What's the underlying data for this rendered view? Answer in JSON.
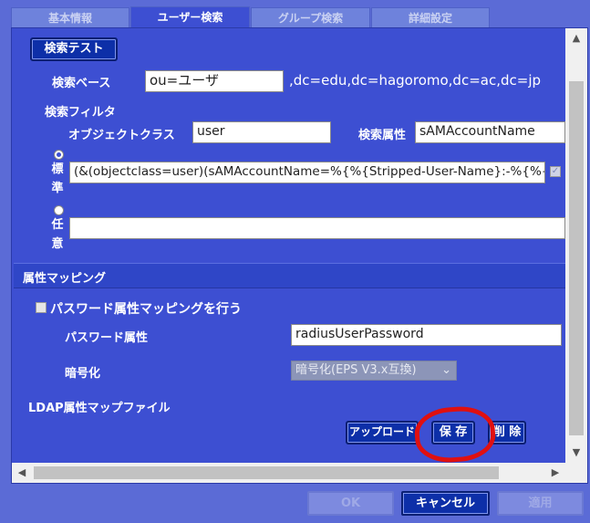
{
  "tabs": [
    {
      "label": "基本情報",
      "active": false
    },
    {
      "label": "ユーザー検索",
      "active": true
    },
    {
      "label": "グループ検索",
      "active": false
    },
    {
      "label": "詳細設定",
      "active": false
    }
  ],
  "search_test_button": "検索テスト",
  "search_base": {
    "label": "検索ベース",
    "value": "ou=ユーザ",
    "suffix": ",dc=edu,dc=hagoromo,dc=ac,dc=jp"
  },
  "search_filter": {
    "heading": "検索フィルタ",
    "object_class_label": "オブジェクトクラス",
    "object_class_value": "user",
    "search_attr_label": "検索属性",
    "search_attr_value": "sAMAccountName",
    "standard_label_1": "標",
    "standard_label_2": "準",
    "standard_value": "(&(objectclass=user)(sAMAccountName=%{%{Stripped-User-Name}:-%{%{El",
    "standard_selected": true,
    "custom_label_1": "任",
    "custom_label_2": "意",
    "custom_value": ""
  },
  "attr_mapping": {
    "heading": "属性マッピング",
    "password_mapping_checkbox_label": "パスワード属性マッピングを行う",
    "password_mapping_checked": false,
    "password_attr_label": "パスワード属性",
    "password_attr_value": "radiusUserPassword",
    "encryption_label": "暗号化",
    "encryption_value": "暗号化(EPS V3.x互換)"
  },
  "ldap_map": {
    "heading": "LDAP属性マップファイル",
    "upload_button": "アップロード",
    "save_button": "保 存",
    "delete_button": "削 除"
  },
  "footer": {
    "ok_label": "OK",
    "cancel_label": "キャンセル",
    "apply_label": "適用"
  },
  "colors": {
    "background": "#5b6bd6",
    "panel": "#3d4fd2",
    "button": "#0d2fa8",
    "annotation": "#e01010"
  }
}
